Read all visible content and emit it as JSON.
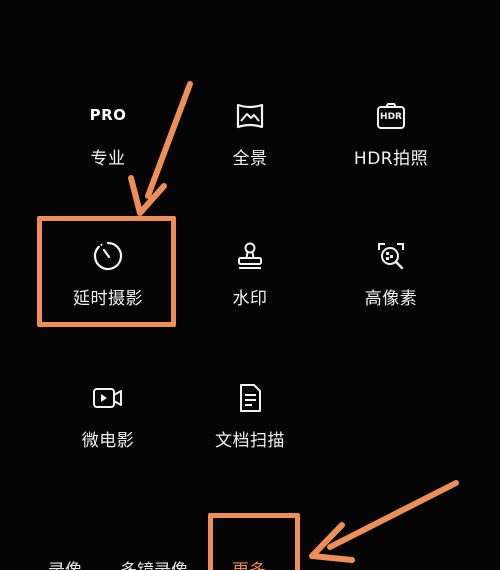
{
  "modes": [
    {
      "label": "专业",
      "icon": "pro-text-icon",
      "icon_text": "PRO"
    },
    {
      "label": "全景",
      "icon": "panorama-icon"
    },
    {
      "label": "HDR拍照",
      "icon": "hdr-icon",
      "icon_text": "HDR"
    },
    {
      "label": "延时摄影",
      "icon": "timelapse-icon"
    },
    {
      "label": "水印",
      "icon": "watermark-stamp-icon"
    },
    {
      "label": "高像素",
      "icon": "high-pixel-icon"
    },
    {
      "label": "微电影",
      "icon": "micro-film-icon"
    },
    {
      "label": "文档扫描",
      "icon": "document-scan-icon"
    }
  ],
  "bottom_bar": {
    "items": [
      "录像",
      "多镜录像",
      "更多"
    ],
    "active": "更多"
  },
  "colors": {
    "background": "#050505",
    "text": "#f2f2f2",
    "annotation": "#ee8f55",
    "active": "#f08a47"
  }
}
